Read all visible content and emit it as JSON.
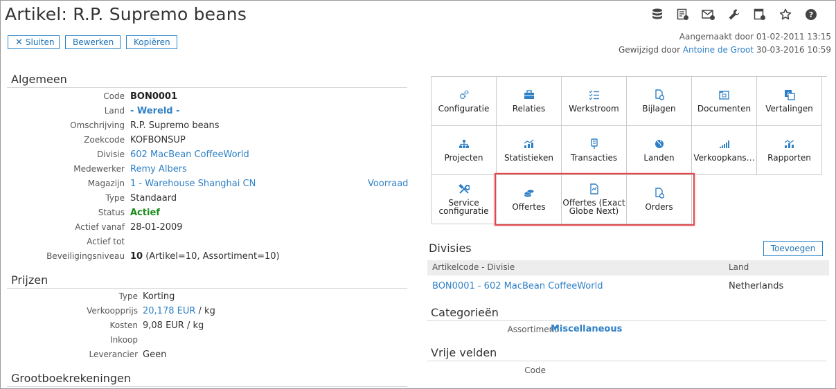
{
  "page": {
    "title": "Artikel: R.P. Supremo beans"
  },
  "toolbar": {
    "close_label": "Sluiten",
    "edit_label": "Bewerken",
    "copy_label": "Kopiëren"
  },
  "meta": {
    "created_label": "Aangemaakt door",
    "created_date": "01-02-2011 13:15",
    "modified_label": "Gewijzigd door",
    "modified_by": "Antoine de Groot",
    "modified_date": "30-03-2016 10:59"
  },
  "top_icons": [
    "database-icon",
    "report-icon",
    "email-icon",
    "wrench-icon",
    "settings-doc-icon",
    "star-icon",
    "help-icon"
  ],
  "general": {
    "heading": "Algemeen",
    "code_label": "Code",
    "code": "BON0001",
    "land_label": "Land",
    "land": "- Wereld -",
    "desc_label": "Omschrijving",
    "desc": "R.P. Supremo beans",
    "search_label": "Zoekcode",
    "search": "KOFBONSUP",
    "division_label": "Divisie",
    "division": "602 MacBean CoffeeWorld",
    "employee_label": "Medewerker",
    "employee": "Remy Albers",
    "warehouse_label": "Magazijn",
    "warehouse": "1 - Warehouse Shanghai CN",
    "stock_link": "Voorraad",
    "type_label": "Type",
    "type": "Standaard",
    "status_label": "Status",
    "status": "Actief",
    "active_from_label": "Actief vanaf",
    "active_from": "28-01-2009",
    "active_to_label": "Actief tot",
    "active_to": "",
    "security_label": "Beveiligingsniveau",
    "security_level": "10",
    "security_detail": " (Artikel=10, Assortiment=10)"
  },
  "prices": {
    "heading": "Prijzen",
    "type_label": "Type",
    "type": "Korting",
    "sale_label": "Verkoopprijs",
    "sale": "20,178 EUR",
    "sale_unit": " / kg",
    "cost_label": "Kosten",
    "cost": "9,08 EUR / kg",
    "purchase_label": "Inkoop",
    "purchase": "",
    "supplier_label": "Leverancier",
    "supplier": "Geen"
  },
  "ledger": {
    "heading": "Grootboekrekeningen"
  },
  "tiles": [
    {
      "label": "Configuratie",
      "icon": "gears-icon"
    },
    {
      "label": "Relaties",
      "icon": "briefcase-icon"
    },
    {
      "label": "Werkstroom",
      "icon": "checklist-icon"
    },
    {
      "label": "Bijlagen",
      "icon": "attachment-icon"
    },
    {
      "label": "Documenten",
      "icon": "documents-icon"
    },
    {
      "label": "Vertalingen",
      "icon": "translations-icon"
    },
    {
      "label": "Projecten",
      "icon": "hierarchy-icon"
    },
    {
      "label": "Statistieken",
      "icon": "statistics-icon"
    },
    {
      "label": "Transacties",
      "icon": "transactions-icon"
    },
    {
      "label": "Landen",
      "icon": "globe-icon"
    },
    {
      "label": "Verkoopkans…",
      "icon": "opportunity-chart-icon"
    },
    {
      "label": "Rapporten",
      "icon": "reports-icon"
    },
    {
      "label": "Service configuratie",
      "icon": "tools-icon"
    },
    {
      "label": "Offertes",
      "icon": "coins-icon"
    },
    {
      "label": "Offertes (Exact Globe Next)",
      "icon": "quote-doc-icon"
    },
    {
      "label": "Orders",
      "icon": "order-doc-icon"
    }
  ],
  "divisions": {
    "heading": "Divisies",
    "add_label": "Toevoegen",
    "col_code": "Artikelcode - Divisie",
    "col_land": "Land",
    "rows": [
      {
        "code": "BON0001 - 602 MacBean CoffeeWorld",
        "land": "Netherlands"
      }
    ]
  },
  "categories": {
    "heading": "Categorieën",
    "assortment_label": "Assortiment",
    "assortment": "Miscellaneous"
  },
  "free_fields": {
    "heading": "Vrije velden",
    "code_label": "Code"
  },
  "colors": {
    "accent": "#2f80c6",
    "active_status": "#1a8a1a",
    "highlight": "#e0484d"
  }
}
